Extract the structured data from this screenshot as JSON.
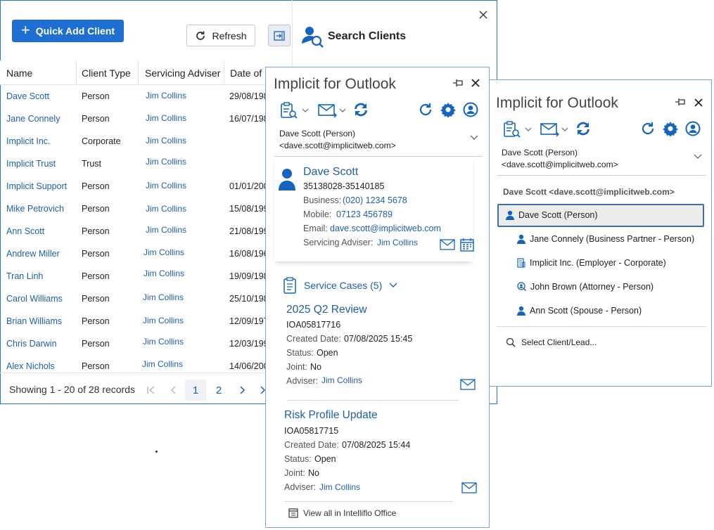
{
  "toolbar": {
    "quick_add_label": "Quick Add Client",
    "refresh_label": "Refresh"
  },
  "search": {
    "title": "Search Clients"
  },
  "table": {
    "columns": [
      "Name",
      "Client Type",
      "Servicing Adviser",
      "Date of"
    ],
    "rows": [
      {
        "name": "Dave Scott",
        "type": "Person",
        "adviser": "Jim Collins",
        "date": "29/08/198"
      },
      {
        "name": "Jane Connely",
        "type": "Person",
        "adviser": "Jim Collins",
        "date": "16/07/198"
      },
      {
        "name": "Implicit Inc.",
        "type": "Corporate",
        "adviser": "Jim Collins",
        "date": ""
      },
      {
        "name": "Implicit Trust",
        "type": "Trust",
        "adviser": "Jim Collins",
        "date": ""
      },
      {
        "name": "Implicit Support",
        "type": "Person",
        "adviser": "Jim Collins",
        "date": "01/01/200"
      },
      {
        "name": "Mike Petrovich",
        "type": "Person",
        "adviser": "Jim Collins",
        "date": "15/08/199"
      },
      {
        "name": "Ann Scott",
        "type": "Person",
        "adviser": "Jim Collins",
        "date": "21/08/199"
      },
      {
        "name": "Andrew Miller",
        "type": "Person",
        "adviser": "Jim Collins",
        "date": "16/08/196"
      },
      {
        "name": "Tran Linh",
        "type": "Person",
        "adviser": "Jim Collins",
        "date": "19/09/198"
      },
      {
        "name": "Carol Williams",
        "type": "Person",
        "adviser": "Jim Collins",
        "date": "25/10/198"
      },
      {
        "name": "Brian Williams",
        "type": "Person",
        "adviser": "Jim Collins",
        "date": "12/09/197"
      },
      {
        "name": "Chris Darwin",
        "type": "Person",
        "adviser": "Jim Collins",
        "date": "12/03/199"
      },
      {
        "name": "Alex Nichols",
        "type": "Person",
        "adviser": "Jim Collins",
        "date": "14/06/200"
      }
    ],
    "footer": "Showing 1 - 20 of 28 records",
    "pages": [
      "1",
      "2"
    ]
  },
  "mid_panel": {
    "title": "Implicit for Outlook",
    "contact_line1": "Dave Scott (Person)",
    "contact_line2": "<dave.scott@implicitweb.com>",
    "client": {
      "name": "Dave Scott",
      "ref": "35138028-35140185",
      "business_label": "Business:",
      "business": "(020) 1234 5678",
      "mobile_label": "Mobile:",
      "mobile": "07123 456789",
      "email_label": "Email:",
      "email": "dave.scott@implicitweb.com",
      "adviser_label": "Servicing Adviser:",
      "adviser": "Jim Collins"
    },
    "service_cases_label": "Service Cases (5)",
    "cases": [
      {
        "title": "2025 Q2 Review",
        "ref": "IOA05817716",
        "created_label": "Created Date:",
        "created": "07/08/2025 15:45",
        "status_label": "Status:",
        "status": "Open",
        "joint_label": "Joint:",
        "joint": "No",
        "adviser_label": "Adviser:",
        "adviser": "Jim Collins"
      },
      {
        "title": "Risk Profile Update",
        "ref": "IOA05817715",
        "created_label": "Created Date:",
        "created": "07/08/2025 15:44",
        "status_label": "Status:",
        "status": "Open",
        "joint_label": "Joint:",
        "joint": "No",
        "adviser_label": "Adviser:",
        "adviser": "Jim Collins"
      }
    ],
    "view_all": "View all in Intelliflo Office"
  },
  "right_panel": {
    "title": "Implicit for Outlook",
    "contact_line1": "Dave Scott (Person)",
    "contact_line2": "<dave.scott@implicitweb.com>",
    "group_header": "Dave Scott <dave.scott@implicitweb.com>",
    "related": [
      {
        "label": "Dave Scott (Person)",
        "icon": "person-icon"
      },
      {
        "label": "Jane Connely (Business Partner - Person)",
        "icon": "person-icon"
      },
      {
        "label": "Implicit Inc. (Employer - Corporate)",
        "icon": "building-icon"
      },
      {
        "label": "John Brown (Attorney - Person)",
        "icon": "person-search-icon"
      },
      {
        "label": "Ann Scott (Spouse - Person)",
        "icon": "person-icon"
      }
    ],
    "select_label": "Select Client/Lead..."
  }
}
